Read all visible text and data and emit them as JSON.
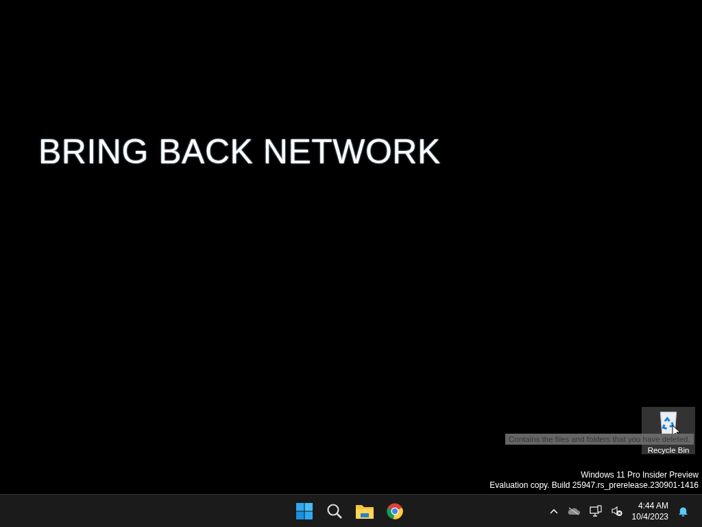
{
  "desktop": {
    "banner": "BRING BACK NETWORK",
    "icons": [
      {
        "label": "Recycle Bin",
        "selected": true
      }
    ],
    "tooltip": "Contains the files and folders that you have deleted.",
    "watermark": [
      "Windows 11 Pro Insider Preview",
      "Evaluation copy. Build 25947.rs_prerelease.230901-1416"
    ]
  },
  "taskbar": {
    "apps": [
      {
        "kind": "start"
      },
      {
        "kind": "search"
      },
      {
        "kind": "explorer"
      },
      {
        "kind": "browser"
      }
    ],
    "tray": {
      "time": "4:44 AM",
      "date": "10/4/2023"
    }
  }
}
